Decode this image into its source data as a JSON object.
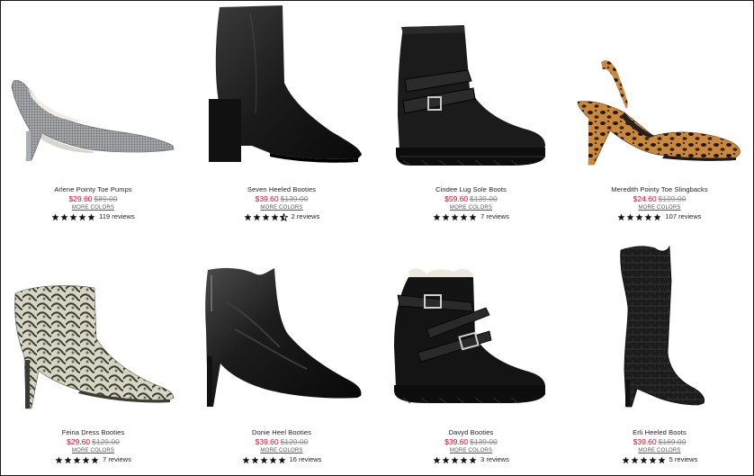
{
  "products": [
    {
      "name": "Arlene Pointy Toe Pumps",
      "sale_price": "$29.60",
      "original_price": "$89.00",
      "more_colors": "MORE COLORS",
      "rating": 5,
      "reviews": "119 reviews",
      "image_icon": "silver-pump-icon"
    },
    {
      "name": "Seven Heeled Booties",
      "sale_price": "$39.60",
      "original_price": "$139.00",
      "more_colors": "MORE COLORS",
      "rating": 4.5,
      "reviews": "2 reviews",
      "image_icon": "black-bootie-icon"
    },
    {
      "name": "Cindee Lug Sole Boots",
      "sale_price": "$59.60",
      "original_price": "$139.00",
      "more_colors": "MORE COLORS",
      "rating": 5,
      "reviews": "7 reviews",
      "image_icon": "lug-boot-icon"
    },
    {
      "name": "Meredith Pointy Toe Slingbacks",
      "sale_price": "$24.60",
      "original_price": "$109.00",
      "more_colors": "MORE COLORS",
      "rating": 5,
      "reviews": "107 reviews",
      "image_icon": "leopard-slingback-icon"
    },
    {
      "name": "Feina Dress Booties",
      "sale_price": "$29.60",
      "original_price": "$129.00",
      "more_colors": "MORE COLORS",
      "rating": 5,
      "reviews": "7 reviews",
      "image_icon": "snake-bootie-icon"
    },
    {
      "name": "Donie Heel Booties",
      "sale_price": "$39.60",
      "original_price": "$129.00",
      "more_colors": "MORE COLORS",
      "rating": 5,
      "reviews": "16 reviews",
      "image_icon": "croc-bootie-icon"
    },
    {
      "name": "Davyd Booties",
      "sale_price": "$39.60",
      "original_price": "$139.00",
      "more_colors": "MORE COLORS",
      "rating": 5,
      "reviews": "3 reviews",
      "image_icon": "buckle-wedge-bootie-icon"
    },
    {
      "name": "Erli Heeled Boots",
      "sale_price": "$39.60",
      "original_price": "$169.00",
      "more_colors": "MORE COLORS",
      "rating": 5,
      "reviews": "5 reviews",
      "image_icon": "tall-croc-boot-icon"
    }
  ],
  "colors": {
    "sale": "#c8102e",
    "original": "#8a8a8a",
    "star": "#111111",
    "text": "#222222"
  }
}
